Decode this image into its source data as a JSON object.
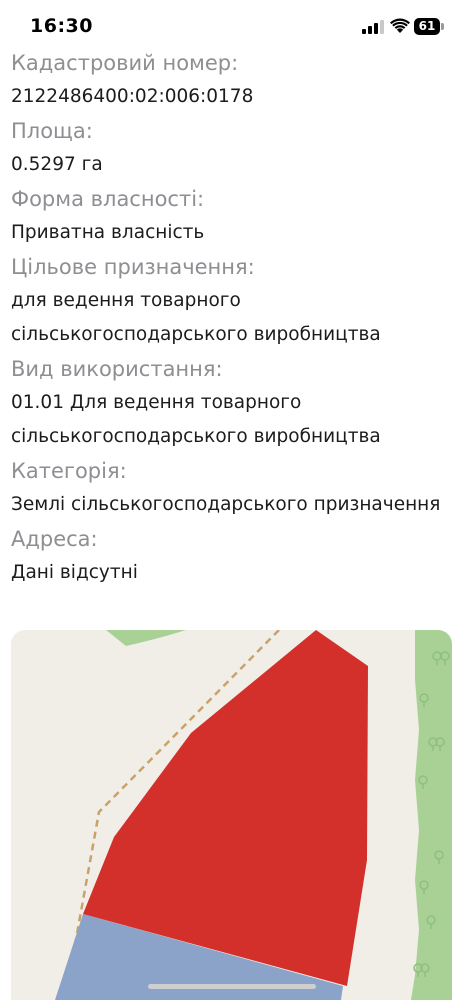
{
  "status": {
    "time": "16:30",
    "battery": "61"
  },
  "fields": [
    {
      "label": "Кадастровий номер:",
      "value_lines": [
        "2122486400:02:006:0178"
      ]
    },
    {
      "label": "Площа:",
      "value_lines": [
        "0.5297 га"
      ]
    },
    {
      "label": "Форма власності:",
      "value_lines": [
        "Приватна власність"
      ]
    },
    {
      "label": "Цільове призначення:",
      "value_lines": [
        "для ведення товарного",
        "сільськогосподарського виробництва"
      ]
    },
    {
      "label": "Вид використання:",
      "value_lines": [
        "01.01 Для ведення товарного",
        "сільськогосподарського виробництва"
      ]
    },
    {
      "label": "Категорія:",
      "value_lines": [
        "Землі сільськогосподарського призначення"
      ]
    },
    {
      "label": "Адреса:",
      "value_lines": [
        "Дані відсутні"
      ]
    }
  ],
  "map": {
    "colors": {
      "background": "#f1eee8",
      "parcel_selected": "#d3302c",
      "parcel_other": "#8ba3c8",
      "forest": "#a9d196",
      "boundary": "#c9a26a",
      "tree": "#93bf84"
    }
  }
}
